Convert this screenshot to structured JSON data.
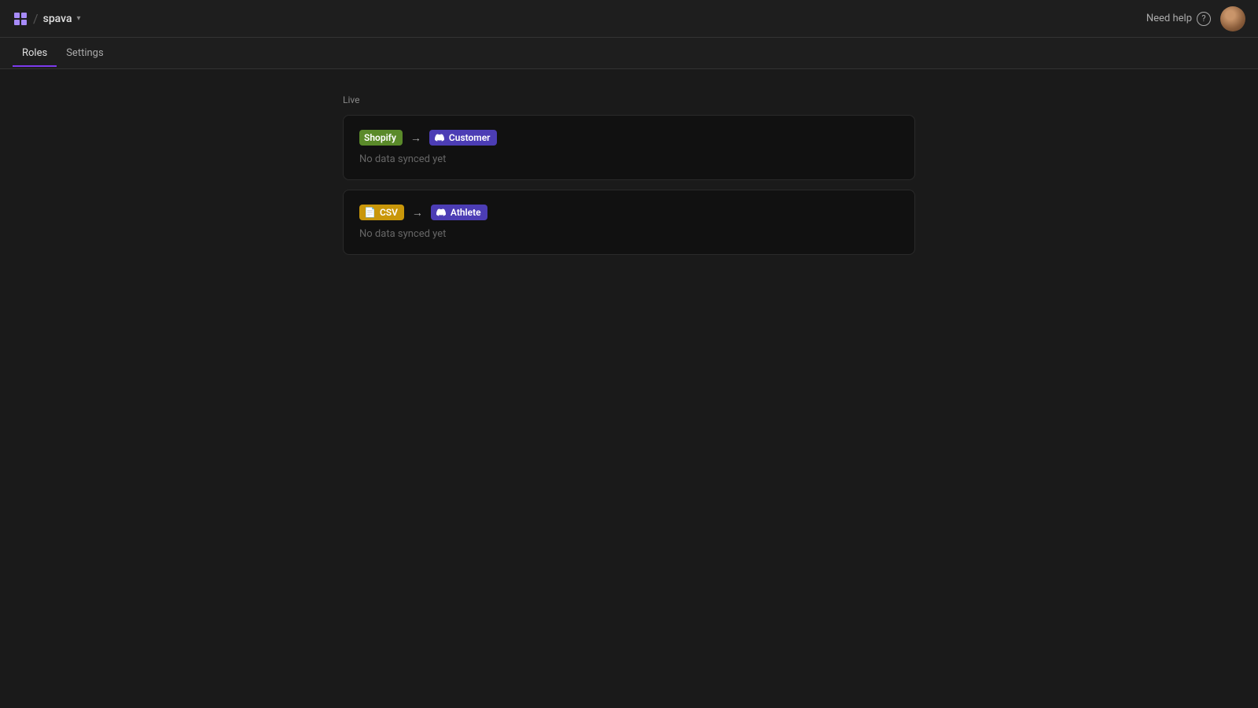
{
  "header": {
    "logo_label": "spava",
    "separator": "/",
    "dropdown_symbol": "▾",
    "need_help_label": "Need help",
    "help_icon": "?",
    "avatar_alt": "User avatar"
  },
  "nav": {
    "tabs": [
      {
        "id": "roles",
        "label": "Roles",
        "active": true
      },
      {
        "id": "settings",
        "label": "Settings",
        "active": false
      }
    ]
  },
  "main": {
    "section_label": "Live",
    "sync_cards": [
      {
        "id": "shopify-customer",
        "source": "Shopify",
        "source_type": "shopify",
        "arrow": "→",
        "destination": "Customer",
        "destination_type": "discord",
        "status_text": "No data synced yet"
      },
      {
        "id": "csv-athlete",
        "source": "CSV",
        "source_type": "csv",
        "arrow": "→",
        "destination": "Athlete",
        "destination_type": "discord",
        "status_text": "No data synced yet"
      }
    ]
  },
  "colors": {
    "shopify_badge": "#5a8a2a",
    "csv_badge": "#c9970a",
    "discord_badge": "#4c3db5",
    "active_tab_underline": "#7c3aed"
  }
}
